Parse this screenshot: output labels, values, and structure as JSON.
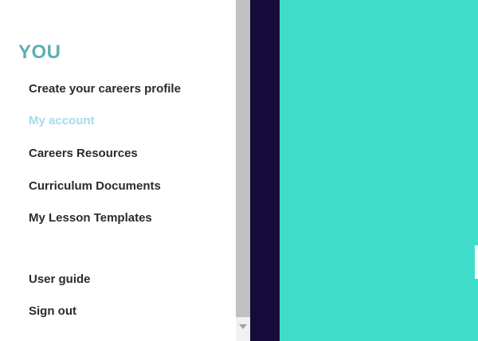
{
  "sidebar": {
    "section_title": "YOU",
    "items": [
      {
        "label": "Create your careers profile",
        "active": false
      },
      {
        "label": "My account",
        "active": true
      },
      {
        "label": "Careers Resources",
        "active": false
      },
      {
        "label": "Curriculum Documents",
        "active": false
      },
      {
        "label": "My Lesson Templates",
        "active": false
      }
    ],
    "footer_items": [
      {
        "label": "User guide"
      },
      {
        "label": "Sign out"
      }
    ]
  },
  "colors": {
    "section_title": "#5ab0b4",
    "active_item": "#a5dbea",
    "item_text": "#2b2b2b",
    "dark_strip": "#170b3b",
    "teal_panel": "#40dcca"
  }
}
